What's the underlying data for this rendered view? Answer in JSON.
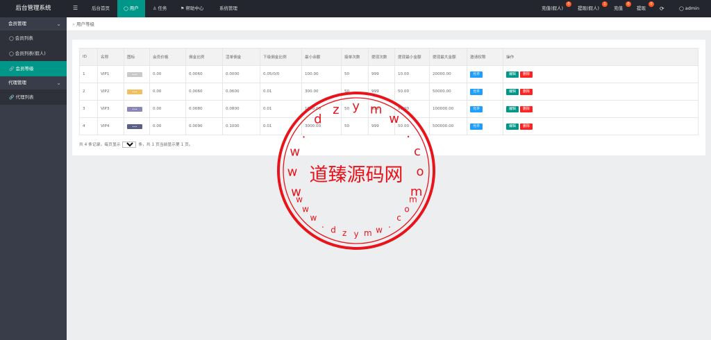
{
  "app": {
    "title": "后台管理系统"
  },
  "header": {
    "menu_icon": "hamburger-icon",
    "nav": [
      {
        "label": "后台首页",
        "icon": ""
      },
      {
        "label": "用户",
        "icon": "user-icon"
      },
      {
        "label": "任务",
        "icon": "person-icon"
      },
      {
        "label": "帮助中心",
        "icon": "flag-icon"
      },
      {
        "label": "系统管理",
        "icon": ""
      }
    ],
    "right": [
      {
        "label": "充值(假人)",
        "badge": "0"
      },
      {
        "label": "提现(假人)",
        "badge": "1"
      },
      {
        "label": "充值",
        "badge": "0"
      },
      {
        "label": "提现",
        "badge": "0"
      }
    ],
    "refresh_icon": "refresh-icon",
    "user": "admin"
  },
  "sidebar": {
    "groups": [
      {
        "label": "会员管理",
        "items": [
          {
            "label": "会员列表"
          },
          {
            "label": "会员列表(假人)"
          },
          {
            "label": "会员等级"
          }
        ]
      },
      {
        "label": "代理管理",
        "items": [
          {
            "label": "代理列表"
          }
        ]
      }
    ]
  },
  "breadcrumb": {
    "label": "用户等级"
  },
  "table": {
    "columns": [
      "ID",
      "名称",
      "图标",
      "会员价格",
      "佣金比例",
      "活单佣金",
      "下级佣金比例",
      "最小余额",
      "接单次数",
      "提现次数",
      "提现最小金额",
      "提现最大金额",
      "邀请权限",
      "操作"
    ],
    "rows": [
      {
        "id": "1",
        "name": "VIP1",
        "icon_color": "#c9c9c9",
        "price": "0.00",
        "commission": "0.0060",
        "order_commission": "0.0000",
        "sub_commission": "0.05/0/0",
        "min_balance": "100.00",
        "orders": "50",
        "withdraw_times": "999",
        "withdraw_min": "10.00",
        "withdraw_max": "20000.00",
        "invite": "允许",
        "edit": "编辑",
        "delete": "删除"
      },
      {
        "id": "2",
        "name": "VIP2",
        "icon_color": "#f0c060",
        "price": "0.00",
        "commission": "0.0060",
        "order_commission": "0.0600",
        "sub_commission": "0.01",
        "min_balance": "300.00",
        "orders": "50",
        "withdraw_times": "999",
        "withdraw_min": "50.00",
        "withdraw_max": "50000.00",
        "invite": "允许",
        "edit": "编辑",
        "delete": "删除"
      },
      {
        "id": "3",
        "name": "VIP3",
        "icon_color": "#8a86b8",
        "price": "0.00",
        "commission": "0.0080",
        "order_commission": "0.0800",
        "sub_commission": "0.01",
        "min_balance": "1000.00",
        "orders": "50",
        "withdraw_times": "999",
        "withdraw_min": "50.00",
        "withdraw_max": "100000.00",
        "invite": "允许",
        "edit": "编辑",
        "delete": "删除"
      },
      {
        "id": "4",
        "name": "VIP4",
        "icon_color": "#5a5f86",
        "price": "0.00",
        "commission": "0.0090",
        "order_commission": "0.1000",
        "sub_commission": "0.01",
        "min_balance": "3000.00",
        "orders": "50",
        "withdraw_times": "999",
        "withdraw_min": "50.00",
        "withdraw_max": "500000.00",
        "invite": "允许",
        "edit": "编辑",
        "delete": "删除"
      }
    ]
  },
  "pager": {
    "prefix": "共 4 条记录，每页显示",
    "per_page": "10",
    "suffix": "条，共 1 页当前显示第 1 页。"
  },
  "watermark": {
    "center_text": "道臻源码网",
    "ring_text": "www.dzymw.com",
    "color": "#e8141c"
  },
  "colors": {
    "accent": "#009688",
    "header_bg": "#23262e",
    "sidebar_bg": "#393d49",
    "badge": "#ff5722",
    "allow": "#1e9fff",
    "delete": "#ff2222"
  }
}
